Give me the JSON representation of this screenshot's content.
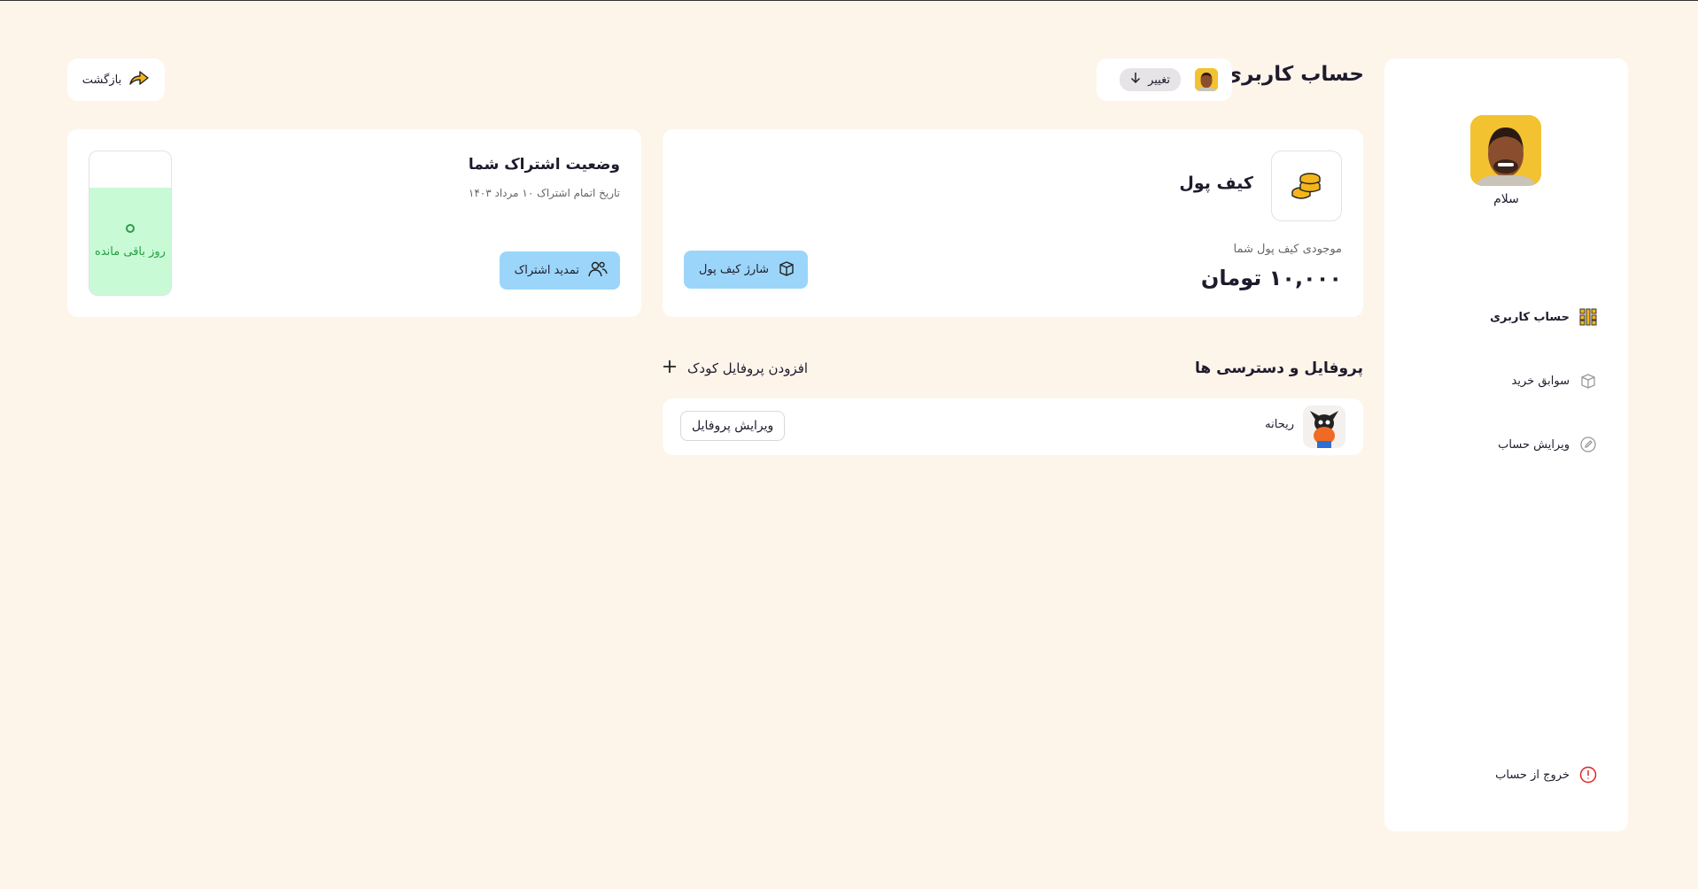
{
  "header": {
    "title": "حساب کاربری",
    "change_label": "تغییر",
    "back_label": "بازگشت"
  },
  "sidebar": {
    "greeting": "سلام",
    "items": [
      {
        "label": "حساب کاربری",
        "icon": "grid-icon",
        "active": true
      },
      {
        "label": "سوابق خرید",
        "icon": "box-icon",
        "active": false
      },
      {
        "label": "ویرایش حساب",
        "icon": "edit-icon",
        "active": false
      }
    ],
    "logout_label": "خروج از حساب"
  },
  "wallet": {
    "title": "کیف پول",
    "balance_label": "موجودی کیف پول شما",
    "balance_value": "۱۰,۰۰۰ تومان",
    "charge_label": "شارژ کیف پول"
  },
  "subscription": {
    "title": "وضعیت اشتراک شما",
    "end_date": "تاریخ اتمام اشتراک ۱۰ مرداد ۱۴۰۳",
    "renew_label": "تمدید اشتراک",
    "days_remaining": "0",
    "days_label": "روز باقی مانده",
    "fill_fraction": 0.75
  },
  "profiles": {
    "title": "پروفایل و دسترسی ها",
    "add_label": "افزودن پروفایل کودک",
    "items": [
      {
        "name": "ریحانه",
        "edit_label": "ویرایش پروفایل"
      }
    ]
  },
  "colors": {
    "background": "#fdf5ea",
    "accent_blue": "#9bd6fa",
    "accent_yellow": "#f2b61b",
    "success_green": "#2a9d44",
    "danger_red": "#e02424"
  }
}
